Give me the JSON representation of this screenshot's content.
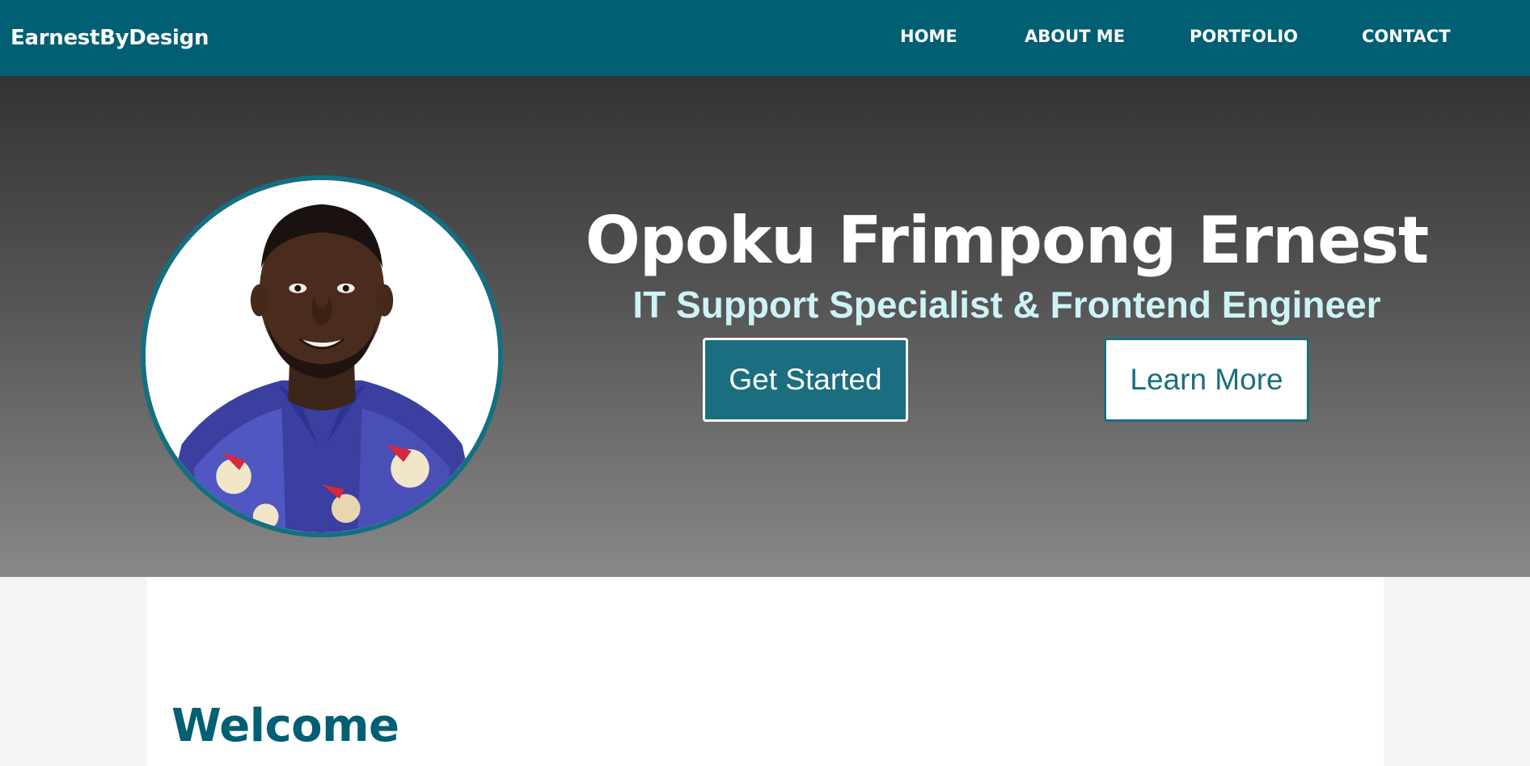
{
  "navbar": {
    "brand": "EarnestByDesign",
    "links": [
      {
        "label": "HOME"
      },
      {
        "label": "ABOUT ME"
      },
      {
        "label": "PORTFOLIO"
      },
      {
        "label": "CONTACT"
      }
    ]
  },
  "hero": {
    "name": "Opoku Frimpong Ernest",
    "subtitle": "IT Support Specialist & Frontend Engineer",
    "primary_button": "Get Started",
    "secondary_button": "Learn More"
  },
  "content": {
    "heading": "Welcome"
  },
  "colors": {
    "nav_bg": "#005f73",
    "accent": "#1a6e80",
    "subtitle": "#cdf3f7",
    "avatar_border": "#136f82"
  },
  "icons": {
    "profile_photo": "profile-photo"
  }
}
